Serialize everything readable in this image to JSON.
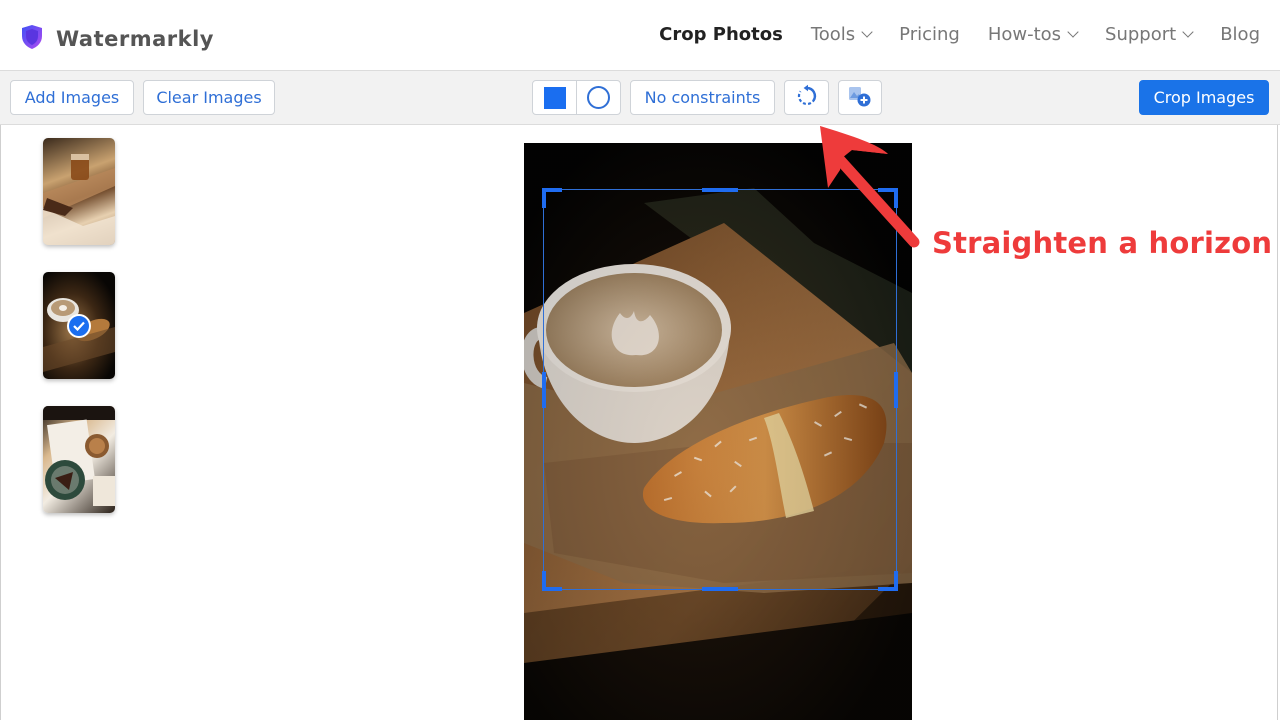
{
  "header": {
    "brand": "Watermarkly",
    "nav": [
      {
        "label": "Crop Photos",
        "active": true,
        "dropdown": false
      },
      {
        "label": "Tools",
        "active": false,
        "dropdown": true
      },
      {
        "label": "Pricing",
        "active": false,
        "dropdown": false
      },
      {
        "label": "How-tos",
        "active": false,
        "dropdown": true
      },
      {
        "label": "Support",
        "active": false,
        "dropdown": true
      },
      {
        "label": "Blog",
        "active": false,
        "dropdown": false
      }
    ]
  },
  "toolbar": {
    "add_images": "Add Images",
    "clear_images": "Clear Images",
    "shape_rect_icon": "square-shape-icon",
    "shape_circle_icon": "circle-shape-icon",
    "constraints": "No constraints",
    "rotate_icon": "rotate-icon",
    "add_image_icon": "add-image-icon",
    "crop_images": "Crop Images"
  },
  "thumbnails": [
    {
      "subject": "iced coffee on wooden tray",
      "selected": false
    },
    {
      "subject": "latte with croissant",
      "selected": true
    },
    {
      "subject": "iced coffee and cake, top view",
      "selected": false
    }
  ],
  "editor": {
    "image_subject": "latte art cup with croissant on parchment"
  },
  "annotation": {
    "text": "Straighten a horizon",
    "color": "#ee3b3b"
  },
  "colors": {
    "accent": "#1a73e8",
    "annotation": "#ee3b3b"
  }
}
